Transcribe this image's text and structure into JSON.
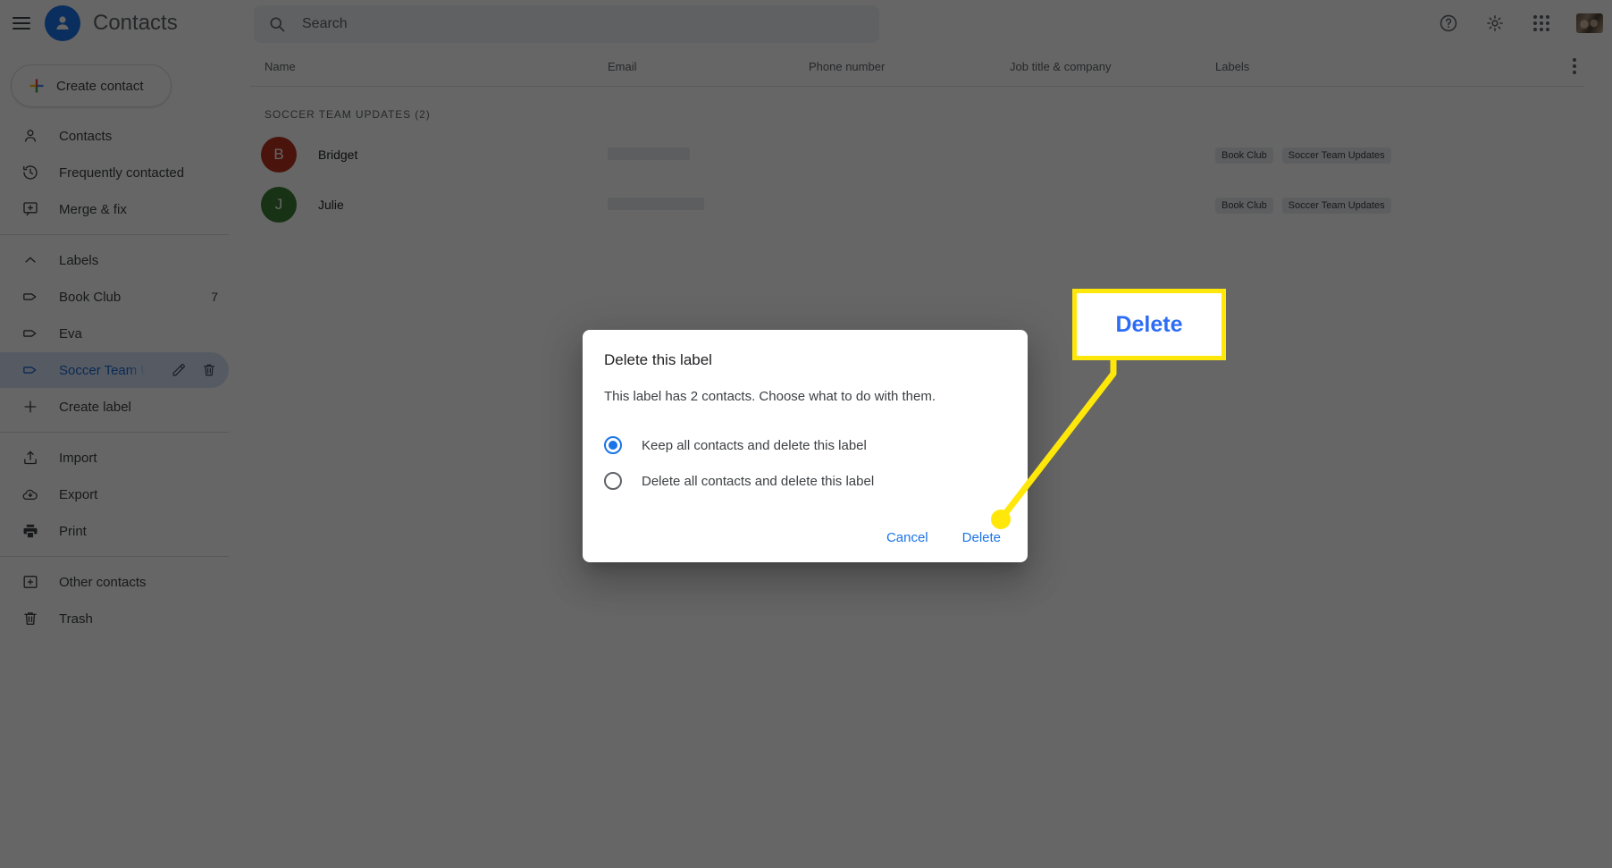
{
  "app": {
    "title": "Contacts",
    "logo_icon": "person-circle-icon",
    "menu_icon": "hamburger-menu-icon"
  },
  "search": {
    "placeholder": "Search",
    "value": "",
    "icon": "search-icon"
  },
  "topbar_actions": [
    {
      "name": "help-icon",
      "label": "Help"
    },
    {
      "name": "gear-icon",
      "label": "Settings"
    },
    {
      "name": "apps-grid-icon",
      "label": "Google apps"
    },
    {
      "name": "avatar",
      "label": "Account"
    }
  ],
  "sidebar": {
    "create_contact": {
      "label": "Create contact",
      "icon": "plus-icon"
    },
    "groups": [
      {
        "items": [
          {
            "label": "Contacts",
            "icon": "person-outline-icon",
            "name": "sidebar-item-contacts"
          },
          {
            "label": "Frequently contacted",
            "icon": "history-clock-icon",
            "name": "sidebar-item-frequently-contacted"
          },
          {
            "label": "Merge & fix",
            "icon": "merge-fix-icon",
            "name": "sidebar-item-merge-and-fix"
          }
        ]
      },
      {
        "header": {
          "label": "Labels",
          "icon": "chevron-up-icon",
          "name": "sidebar-section-labels"
        },
        "items": [
          {
            "label": "Book Club",
            "icon": "label-tag-icon",
            "count": "7",
            "name": "sidebar-item-book-club"
          },
          {
            "label": "Eva",
            "icon": "label-tag-icon",
            "count": "",
            "name": "sidebar-item-eva"
          },
          {
            "label": "Soccer Team Up",
            "icon": "label-tag-icon",
            "count": "",
            "name": "sidebar-item-soccer-team-updates",
            "active": true,
            "actions": [
              "pencil-edit-icon",
              "trash-delete-icon"
            ]
          },
          {
            "label": "Create label",
            "icon": "plus-icon",
            "count": "",
            "name": "sidebar-item-create-label"
          }
        ]
      },
      {
        "items": [
          {
            "label": "Import",
            "icon": "import-upload-icon",
            "name": "sidebar-item-import"
          },
          {
            "label": "Export",
            "icon": "export-cloud-download-icon",
            "name": "sidebar-item-export"
          },
          {
            "label": "Print",
            "icon": "printer-icon",
            "name": "sidebar-item-print"
          }
        ]
      },
      {
        "items": [
          {
            "label": "Other contacts",
            "icon": "other-contacts-icon",
            "name": "sidebar-item-other-contacts"
          },
          {
            "label": "Trash",
            "icon": "trash-delete-icon",
            "name": "sidebar-item-trash"
          }
        ]
      }
    ]
  },
  "table": {
    "columns": [
      "Name",
      "Email",
      "Phone number",
      "Job title & company",
      "Labels"
    ],
    "more_icon": "kebab-more-icon",
    "group_title": "SOCCER TEAM UPDATES (2)",
    "rows": [
      {
        "initial": "B",
        "avatar_color": "#b93221",
        "name": "Bridget",
        "email": "",
        "phone": "",
        "job": "",
        "labels": [
          "Book Club",
          "Soccer Team Updates"
        ]
      },
      {
        "initial": "J",
        "avatar_color": "#3a7d32",
        "name": "Julie",
        "email": "",
        "phone": "",
        "job": "",
        "labels": [
          "Book Club",
          "Soccer Team Updates"
        ]
      }
    ]
  },
  "dialog": {
    "title": "Delete this label",
    "body": "This label has 2 contacts. Choose what to do with them.",
    "options": [
      {
        "label": "Keep all contacts and delete this label",
        "selected": true
      },
      {
        "label": "Delete all contacts and delete this label",
        "selected": false
      }
    ],
    "cancel_label": "Cancel",
    "delete_label": "Delete"
  },
  "annotation": {
    "callout_label": "Delete",
    "callout_text_color": "#2d6df6",
    "highlight_color": "#ffe70a"
  }
}
